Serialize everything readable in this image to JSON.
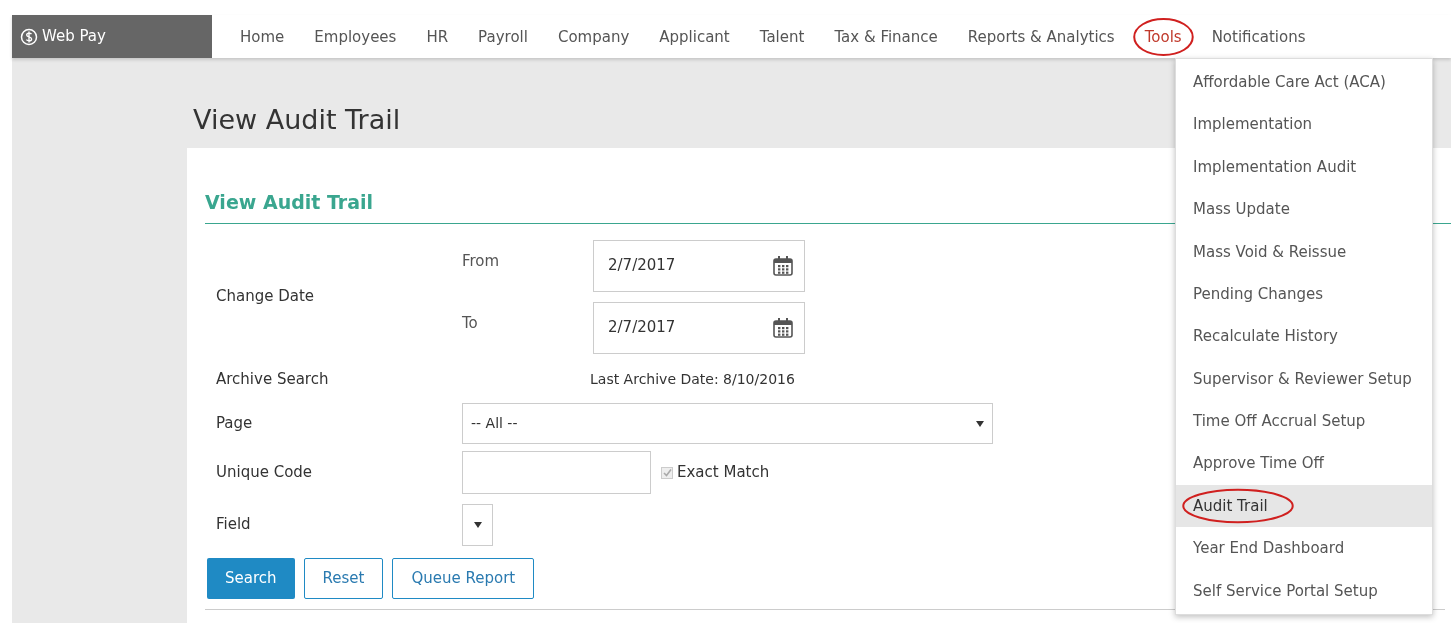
{
  "brand": {
    "name": "Web Pay"
  },
  "nav": [
    {
      "label": "Home",
      "circled": false
    },
    {
      "label": "Employees",
      "circled": false
    },
    {
      "label": "HR",
      "circled": false
    },
    {
      "label": "Payroll",
      "circled": false
    },
    {
      "label": "Company",
      "circled": false
    },
    {
      "label": "Applicant",
      "circled": false
    },
    {
      "label": "Talent",
      "circled": false
    },
    {
      "label": "Tax & Finance",
      "circled": false
    },
    {
      "label": "Reports & Analytics",
      "circled": false
    },
    {
      "label": "Tools",
      "circled": true
    },
    {
      "label": "Notifications",
      "circled": false
    }
  ],
  "page_title": "View Audit Trail",
  "card_title": "View Audit Trail",
  "form": {
    "change_date_label": "Change Date",
    "from_label": "From",
    "from_value": "2/7/2017",
    "to_label": "To",
    "to_value": "2/7/2017",
    "archive_label": "Archive Search",
    "archive_note": "Last Archive Date: 8/10/2016",
    "page_label": "Page",
    "page_value": "-- All --",
    "code_label": "Unique Code",
    "exact_match": {
      "label": "Exact Match",
      "checked": true,
      "disabled": true
    },
    "field_label": "Field"
  },
  "buttons": [
    {
      "label": "Search",
      "kind": "primary"
    },
    {
      "label": "Reset",
      "kind": "secondary"
    },
    {
      "label": "Queue Report",
      "kind": "secondary"
    }
  ],
  "tools_menu": [
    {
      "label": "Affordable Care Act (ACA)",
      "selected": false,
      "circled": false
    },
    {
      "label": "Implementation",
      "selected": false,
      "circled": false
    },
    {
      "label": "Implementation Audit",
      "selected": false,
      "circled": false
    },
    {
      "label": "Mass Update",
      "selected": false,
      "circled": false
    },
    {
      "label": "Mass Void & Reissue",
      "selected": false,
      "circled": false
    },
    {
      "label": "Pending Changes",
      "selected": false,
      "circled": false
    },
    {
      "label": "Recalculate History",
      "selected": false,
      "circled": false
    },
    {
      "label": "Supervisor & Reviewer Setup",
      "selected": false,
      "circled": false
    },
    {
      "label": "Time Off Accrual Setup",
      "selected": false,
      "circled": false
    },
    {
      "label": "Approve Time Off",
      "selected": false,
      "circled": false
    },
    {
      "label": "Audit Trail",
      "selected": true,
      "circled": true
    },
    {
      "label": "Year End Dashboard",
      "selected": false,
      "circled": false
    },
    {
      "label": "Self Service Portal Setup",
      "selected": false,
      "circled": false
    }
  ]
}
